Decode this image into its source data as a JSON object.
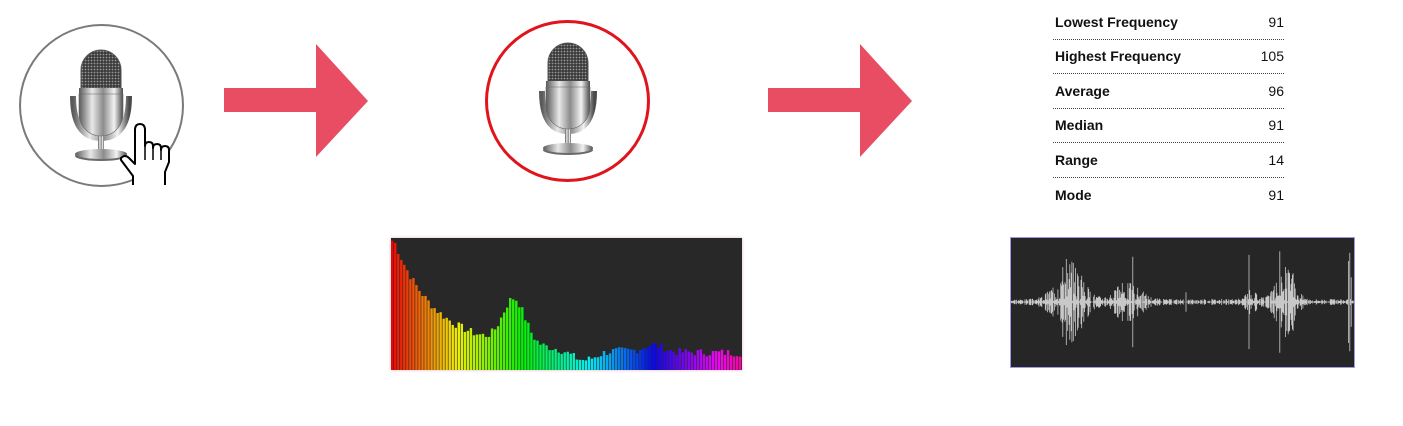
{
  "flow": {
    "steps": [
      "mic-idle",
      "mic-recording",
      "analysis"
    ],
    "colors": {
      "arrow": "#e84d63",
      "recording_ring": "#e0141c",
      "idle_ring": "#7a7a7a",
      "panel_background": "#282828",
      "waveform_color": "#c8c8c8"
    },
    "icons": [
      "microphone-icon",
      "hand-cursor-icon",
      "arrow-right-icon"
    ]
  },
  "stats": {
    "rows": [
      {
        "label": "Lowest Frequency",
        "value": "91"
      },
      {
        "label": "Highest Frequency",
        "value": "105"
      },
      {
        "label": "Average",
        "value": "96"
      },
      {
        "label": "Median",
        "value": "91"
      },
      {
        "label": "Range",
        "value": "14"
      },
      {
        "label": "Mode",
        "value": "91"
      }
    ]
  }
}
